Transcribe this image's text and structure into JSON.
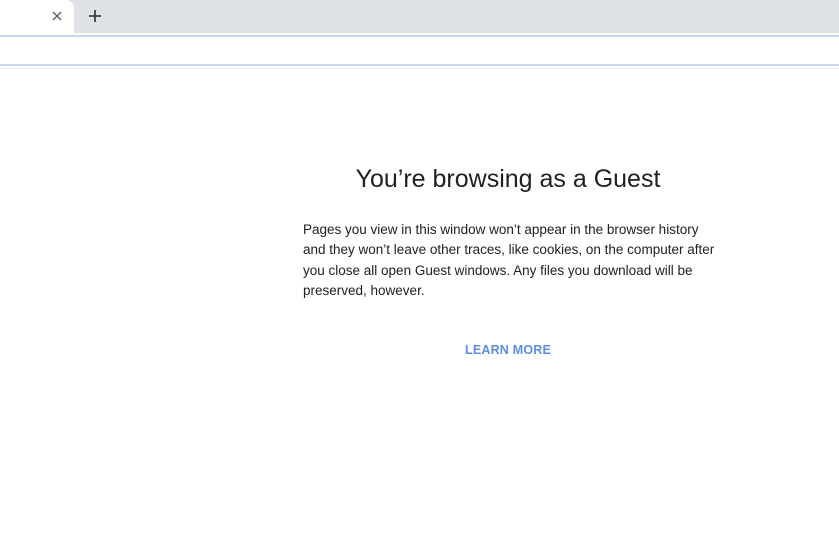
{
  "tabstrip": {
    "close_icon": "close-icon",
    "new_tab_icon": "plus-icon"
  },
  "main": {
    "title": "You’re browsing as a Guest",
    "description": "Pages you view in this window won’t appear in the browser history and they won’t leave other traces, like cookies, on the computer after you close all open Guest windows. Any files you download will be preserved, however.",
    "learn_more_label": "LEARN MORE"
  },
  "colors": {
    "tabstrip_bg": "#dee1e6",
    "accent_link": "#5a8ee6",
    "text": "#202124"
  }
}
